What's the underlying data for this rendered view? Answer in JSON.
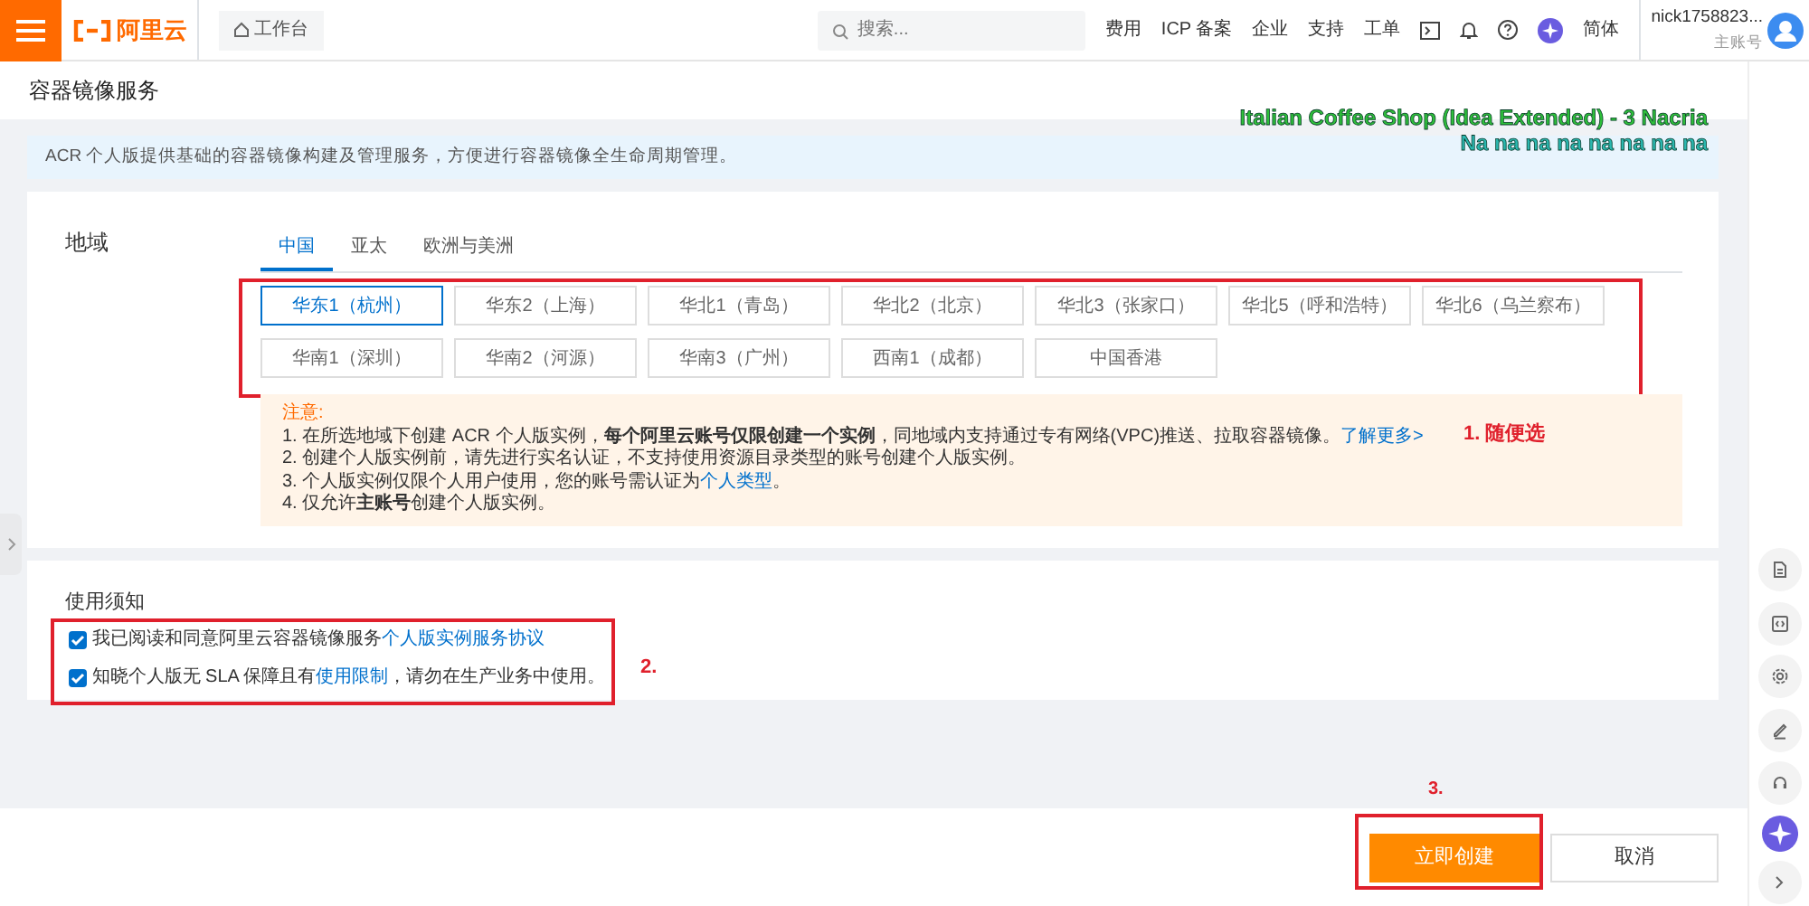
{
  "header": {
    "brand": "阿里云",
    "workbench": "工作台",
    "search": {
      "placeholder": "搜索..."
    },
    "nav": [
      "费用",
      "ICP 备案",
      "企业",
      "支持",
      "工单"
    ],
    "language": "简体",
    "user": {
      "name": "nick1758823...",
      "role": "主账号"
    }
  },
  "page_title": "容器镜像服务",
  "overlay_lines": [
    "Italian Coffee Shop (Idea Extended) -  3 Nacria",
    "Na na na na na na na na"
  ],
  "banner": "ACR 个人版提供基础的容器镜像构建及管理服务，方便进行容器镜像全生命周期管理。",
  "region": {
    "label": "地域",
    "tabs": [
      {
        "label": "中国",
        "selected": true
      },
      {
        "label": "亚太",
        "selected": false
      },
      {
        "label": "欧洲与美洲",
        "selected": false
      }
    ],
    "options": [
      {
        "label": "华东1（杭州）",
        "selected": true
      },
      {
        "label": "华东2（上海）",
        "selected": false
      },
      {
        "label": "华北1（青岛）",
        "selected": false
      },
      {
        "label": "华北2（北京）",
        "selected": false
      },
      {
        "label": "华北3（张家口）",
        "selected": false
      },
      {
        "label": "华北5（呼和浩特）",
        "selected": false
      },
      {
        "label": "华北6（乌兰察布）",
        "selected": false
      },
      {
        "label": "华南1（深圳）",
        "selected": false
      },
      {
        "label": "华南2（河源）",
        "selected": false
      },
      {
        "label": "华南3（广州）",
        "selected": false
      },
      {
        "label": "西南1（成都）",
        "selected": false
      },
      {
        "label": "中国香港",
        "selected": false
      }
    ]
  },
  "notice": {
    "title": "注意:",
    "items": [
      {
        "before": "1. 在所选地域下创建 ACR 个人版实例，**每个阿里云账号仅限创建一个实例**，同地域内支持通过专有网络(VPC)推送、拉取容器镜像。",
        "link": "了解更多>"
      },
      {
        "before": "2. 创建个人版实例前，请先进行实名认证，不支持使用资源目录类型的账号创建个人版实例。"
      },
      {
        "before": "3. 个人版实例仅限个人用户使用，您的账号需认证为",
        "link": "个人类型",
        "after": "。"
      },
      {
        "before": "4. 仅允许**主账号**创建个人版实例。"
      }
    ]
  },
  "terms": {
    "title": "使用须知",
    "items": [
      {
        "checked": true,
        "before": "我已阅读和同意阿里云容器镜像服务",
        "link": "个人版实例服务协议"
      },
      {
        "checked": true,
        "before": "知晓个人版无 SLA 保障且有",
        "link": "使用限制",
        "after": "，请勿在生产业务中使用。"
      }
    ]
  },
  "annotations": [
    "1. 随便选",
    "2.",
    "3."
  ],
  "footer": {
    "create": "立即创建",
    "cancel": "取消"
  }
}
